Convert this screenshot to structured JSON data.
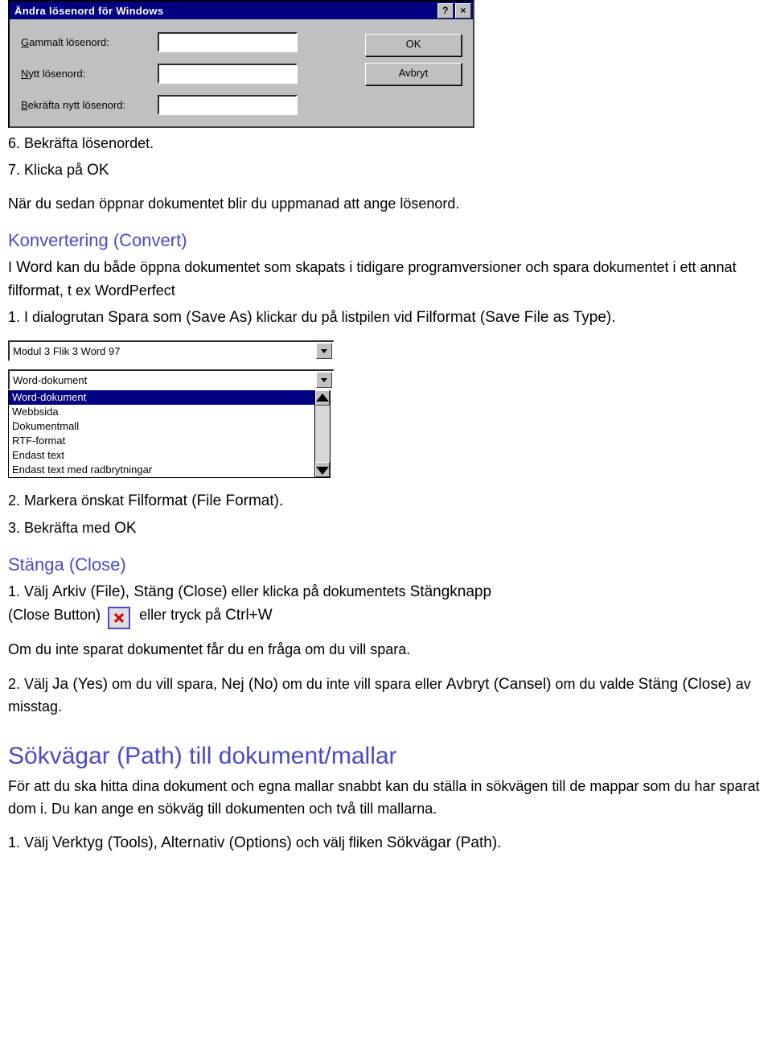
{
  "dialog": {
    "title": "Ändra lösenord för Windows",
    "fields": {
      "old_underline": "G",
      "old_rest": "ammalt lösenord:",
      "new_underline": "N",
      "new_rest": "ytt lösenord:",
      "conf_underline": "B",
      "conf_rest": "ekräfta nytt lösenord:"
    },
    "buttons": {
      "ok": "OK",
      "cancel": "Avbryt"
    },
    "help_glyph": "?",
    "close_glyph": "×"
  },
  "doc": {
    "p1": "6. Bekräfta lösenordet.",
    "p2a": "7. Klicka på ",
    "p2b": "OK",
    "p3": "När du sedan öppnar dokumentet blir du uppmanad att ange lösenord.",
    "h1": "Konvertering (Convert)",
    "p4a": "I ",
    "p4b": "Word",
    "p4c": " kan du både öppna dokumentet som skapats i tidigare programversioner och spara dokumentet i ett annat filformat, t ex WordPerfect",
    "p5a": "1. I dialogrutan ",
    "p5b": "Spara som (Save As)",
    "p5c": " klickar du på listpilen vid ",
    "p5d": "Filformat (Save File as Type).",
    "combo_top": "Modul 3 Flik 3  Word 97",
    "combo_selected": "Word-dokument",
    "combo_items": [
      "Word-dokument",
      "Webbsida",
      "Dokumentmall",
      "RTF-format",
      "Endast text",
      "Endast text med radbrytningar"
    ],
    "p6a": "2. Markera önskat ",
    "p6b": "Filformat (File Format).",
    "p7a": "3. Bekräfta med ",
    "p7b": "OK",
    "h2": "Stänga (Close)",
    "p8a": "1. Välj ",
    "p8b": "Arkiv (File), Stäng (Close)",
    "p8c": " eller klicka på dokumentets ",
    "p8d": "Stängknapp",
    "p8e": "(Close Button) ",
    "p8f": " eller tryck på ",
    "p8g": "Ctrl+W",
    "p9": "Om du inte sparat dokumentet får du en fråga om du vill spara.",
    "p10a": "2. Välj ",
    "p10b": "Ja (Yes)",
    "p10c": " om du vill spara, ",
    "p10d": "Nej (No)",
    "p10e": " om du inte vill spara eller ",
    "p10f": "Avbryt (Cansel)",
    "p10g": " om du valde ",
    "p10h": "Stäng (Close)",
    "p10i": " av misstag.",
    "h3": "Sökvägar (Path) till dokument/mallar",
    "p11": "För att du ska hitta dina dokument och egna mallar snabbt kan du ställa in sökvägen till de mappar som du har sparat dom i. Du kan ange en sökväg till dokumenten och två till mallarna.",
    "p12a": "1. Välj ",
    "p12b": "Verktyg (Tools), Alternativ (Options)",
    "p12c": " och välj fliken ",
    "p12d": "Sökvägar (Path)."
  }
}
